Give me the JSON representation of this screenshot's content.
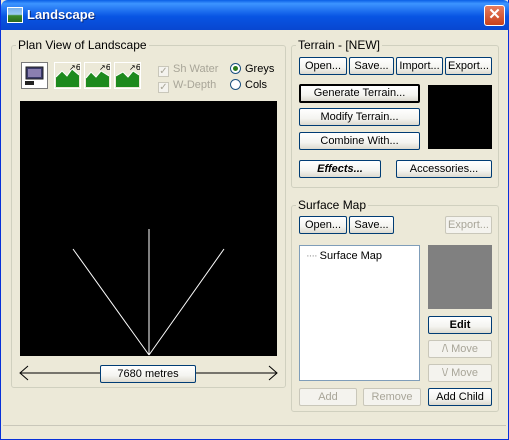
{
  "window": {
    "title": "Landscape",
    "close_glyph": "✕"
  },
  "plan_view": {
    "legend": "Plan View of Landscape",
    "tools": [
      "monitor-icon",
      "terrain-icon",
      "terrain-icon",
      "terrain-icon"
    ],
    "checkboxes": [
      {
        "label": "Sh Water",
        "checked": true,
        "enabled": false
      },
      {
        "label": "W-Depth",
        "checked": true,
        "enabled": false
      }
    ],
    "radios": [
      {
        "label": "Greys",
        "selected": true
      },
      {
        "label": "Cols",
        "selected": false
      }
    ],
    "scale_label": "7680 metres",
    "preview_color": "#000000"
  },
  "terrain": {
    "legend": "Terrain - [NEW]",
    "open": "Open...",
    "save": "Save...",
    "import": "Import...",
    "export": "Export...",
    "generate": "Generate Terrain...",
    "modify": "Modify Terrain...",
    "combine": "Combine With...",
    "effects": "Effects...",
    "accessories": "Accessories..."
  },
  "surface_map": {
    "legend": "Surface Map",
    "open": "Open...",
    "save": "Save...",
    "export": "Export...",
    "tree_item": "Surface Map",
    "edit": "Edit",
    "move_up": "/\\ Move",
    "move_down": "\\/ Move",
    "add": "Add",
    "remove": "Remove",
    "add_child": "Add Child",
    "swatch_color": "#808080"
  }
}
